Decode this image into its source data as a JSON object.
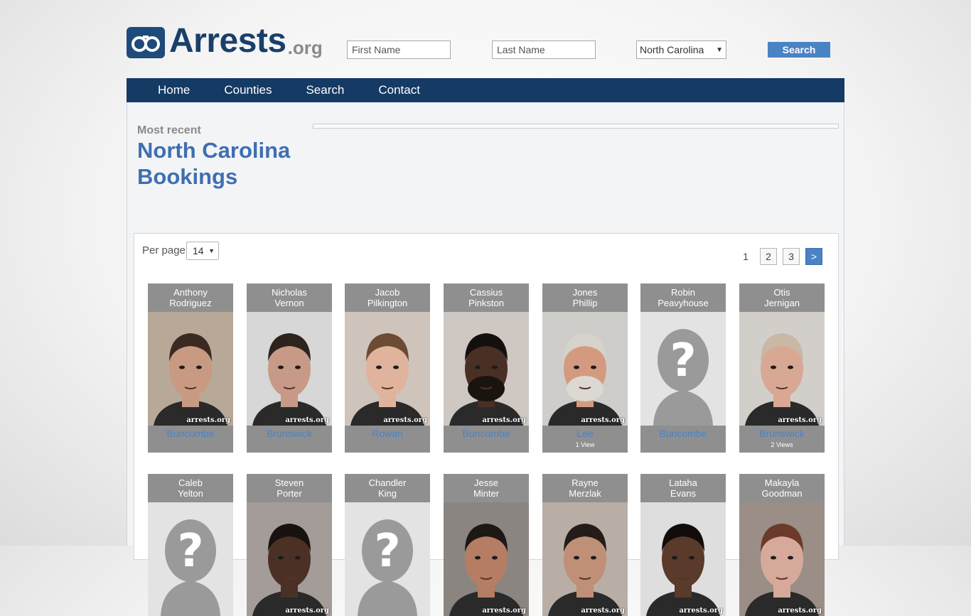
{
  "header": {
    "logo_text": "Arrests",
    "logo_tld": ".org",
    "first_name_placeholder": "First Name",
    "last_name_placeholder": "Last Name",
    "state_selected": "North Carolina",
    "search_label": "Search"
  },
  "nav": {
    "items": [
      "Home",
      "Counties",
      "Search",
      "Contact"
    ]
  },
  "main": {
    "most_recent": "Most recent",
    "title": "North Carolina Bookings",
    "per_page_label": "Per page",
    "per_page_value": "14",
    "pagination": {
      "current": "1",
      "pages": [
        "2",
        "3"
      ],
      "next": ">"
    },
    "watermark": "arrests.org"
  },
  "bookings": [
    {
      "first": "Anthony",
      "last": "Rodriguez",
      "county": "Buncombe",
      "views": "",
      "photo": "mugshot",
      "skin": "#c99a82",
      "hair": "#3a2a22",
      "bg": "#b8a898",
      "beard": false
    },
    {
      "first": "Nicholas",
      "last": "Vernon",
      "county": "Brunswick",
      "views": "",
      "photo": "mugshot",
      "skin": "#c69a86",
      "hair": "#2e241e",
      "bg": "#d7d7d7",
      "beard": false
    },
    {
      "first": "Jacob",
      "last": "Pilkington",
      "county": "Rowan",
      "views": "",
      "photo": "mugshot",
      "skin": "#e0b39c",
      "hair": "#6b4b33",
      "bg": "#cfc4bb",
      "beard": false
    },
    {
      "first": "Cassius",
      "last": "Pinkston",
      "county": "Buncombe",
      "views": "",
      "photo": "mugshot",
      "skin": "#4a2f24",
      "hair": "#141010",
      "bg": "#cfc8c2",
      "beard": true
    },
    {
      "first": "Jones",
      "last": "Phillip",
      "county": "Lee",
      "views": "1 View",
      "photo": "mugshot",
      "skin": "#d49a80",
      "hair": "#d6d2cc",
      "bg": "#cfcdc9",
      "beard": true
    },
    {
      "first": "Robin",
      "last": "Peavyhouse",
      "county": "Buncombe",
      "views": "",
      "photo": "placeholder",
      "skin": "",
      "hair": "",
      "bg": "",
      "beard": false
    },
    {
      "first": "Otis",
      "last": "Jernigan",
      "county": "Brunswick",
      "views": "2 Views",
      "photo": "mugshot",
      "skin": "#d9a894",
      "hair": "#c9b8a6",
      "bg": "#d2cfcb",
      "beard": false
    },
    {
      "first": "Caleb",
      "last": "Yelton",
      "county": "",
      "views": "",
      "photo": "placeholder",
      "skin": "",
      "hair": "",
      "bg": "",
      "beard": false
    },
    {
      "first": "Steven",
      "last": "Porter",
      "county": "",
      "views": "",
      "photo": "mugshot",
      "skin": "#4b3125",
      "hair": "#1a1210",
      "bg": "#a49c98",
      "beard": false
    },
    {
      "first": "Chandler",
      "last": "King",
      "county": "",
      "views": "",
      "photo": "placeholder",
      "skin": "",
      "hair": "",
      "bg": "",
      "beard": false
    },
    {
      "first": "Jesse",
      "last": "Minter",
      "county": "",
      "views": "",
      "photo": "mugshot",
      "skin": "#b57d63",
      "hair": "#1c1814",
      "bg": "#8b8582",
      "beard": false
    },
    {
      "first": "Rayne",
      "last": "Merzlak",
      "county": "",
      "views": "",
      "photo": "mugshot",
      "skin": "#c08f78",
      "hair": "#241c18",
      "bg": "#b8aea6",
      "beard": false
    },
    {
      "first": "Lataha",
      "last": "Evans",
      "county": "",
      "views": "",
      "photo": "mugshot",
      "skin": "#5a3a2b",
      "hair": "#120d0b",
      "bg": "#dedede",
      "beard": false
    },
    {
      "first": "Makayla",
      "last": "Goodman",
      "county": "",
      "views": "",
      "photo": "mugshot",
      "skin": "#d7a99a",
      "hair": "#6b3a2a",
      "bg": "#9a8e86",
      "beard": false
    }
  ]
}
